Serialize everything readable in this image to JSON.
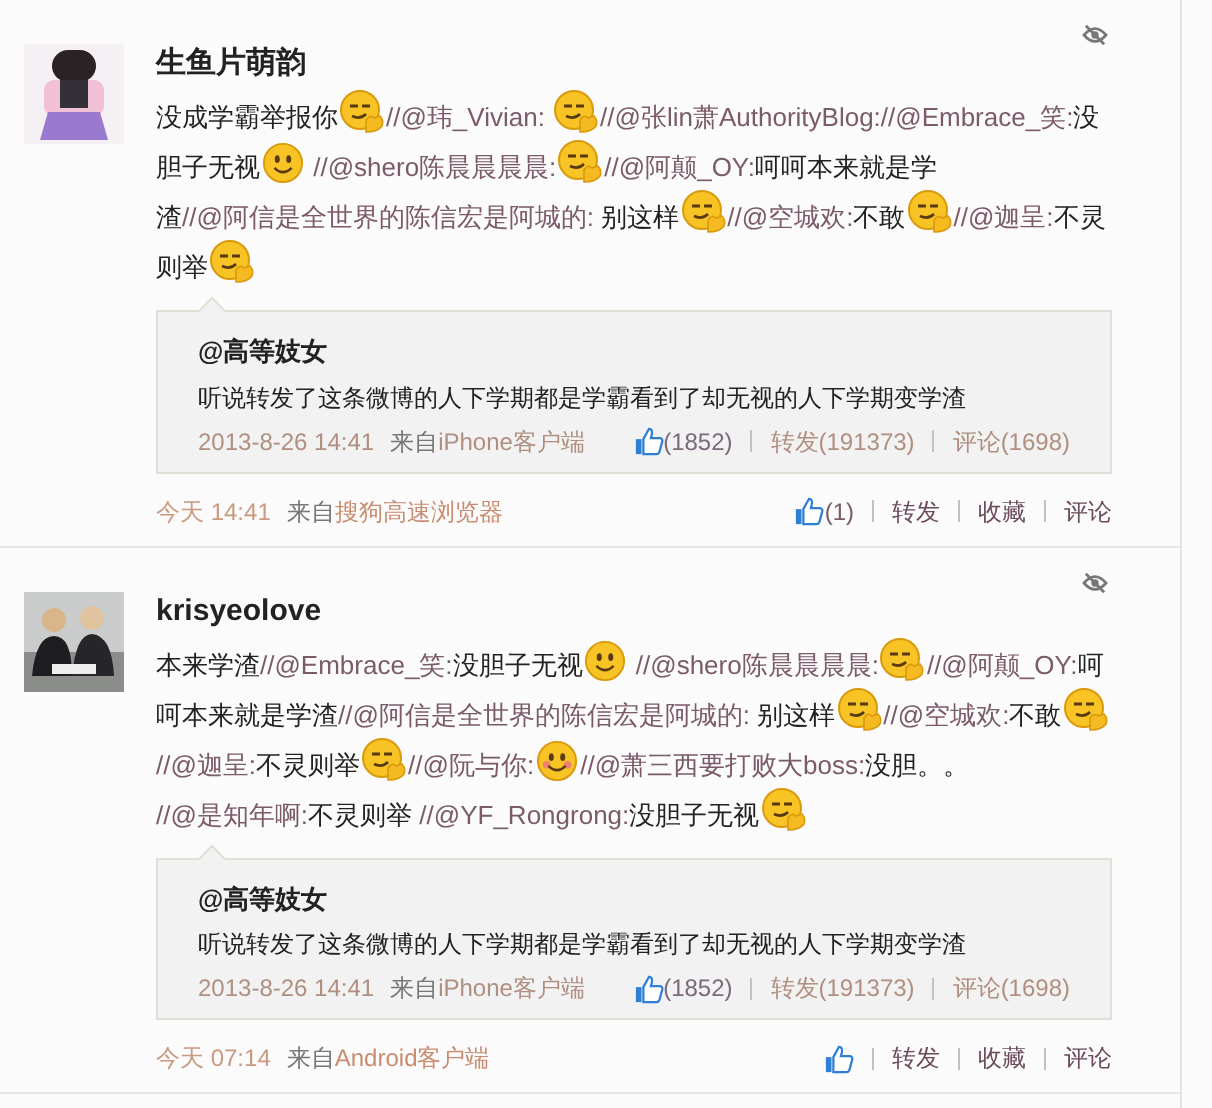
{
  "posts": [
    {
      "author": "生鱼片萌韵",
      "segments": [
        {
          "kind": "text",
          "text": "没成学霸举报你"
        },
        {
          "kind": "smirk"
        },
        {
          "kind": "mention",
          "text": "//@玮_Vivian: "
        },
        {
          "kind": "smirk"
        },
        {
          "kind": "mention",
          "text": "//@张lin萧AuthorityBlog:"
        },
        {
          "kind": "mention",
          "text": "//@Embrace_笑:"
        },
        {
          "kind": "text",
          "text": "没胆子无视"
        },
        {
          "kind": "smile"
        },
        {
          "kind": "mention",
          "text": " //@shero陈晨晨晨晨:"
        },
        {
          "kind": "smirk"
        },
        {
          "kind": "mention",
          "text": "//@阿颠_OY:"
        },
        {
          "kind": "text",
          "text": "呵呵本来就是学渣"
        },
        {
          "kind": "mention",
          "text": "//@阿信是全世界的陈信宏是阿城的:"
        },
        {
          "kind": "text",
          "text": " 别这样"
        },
        {
          "kind": "smirk"
        },
        {
          "kind": "mention",
          "text": "//@空城欢:"
        },
        {
          "kind": "text",
          "text": "不敢"
        },
        {
          "kind": "smirk"
        },
        {
          "kind": "mention",
          "text": "//@迦呈:"
        },
        {
          "kind": "text",
          "text": "不灵则举"
        },
        {
          "kind": "smirk"
        }
      ],
      "retweet": {
        "author": "@高等妓女",
        "text": "听说转发了这条微博的人下学期都是学霸看到了却无视的人下学期变学渣",
        "time": "2013-8-26 14:41",
        "source_label": "来自",
        "source": "iPhone客户端",
        "likes": "(1852)",
        "reposts": "转发(191373)",
        "comments": "评论(1698)"
      },
      "time": "今天 14:41",
      "source_label": "来自",
      "source": "搜狗高速浏览器",
      "likes": "(1)",
      "actions": [
        "转发",
        "收藏",
        "评论"
      ]
    },
    {
      "author": "krisyeolove",
      "segments": [
        {
          "kind": "text",
          "text": "本来学渣"
        },
        {
          "kind": "mention",
          "text": "//@Embrace_笑:"
        },
        {
          "kind": "text",
          "text": "没胆子无视"
        },
        {
          "kind": "smile"
        },
        {
          "kind": "mention",
          "text": " //@shero陈晨晨晨晨:"
        },
        {
          "kind": "smirk"
        },
        {
          "kind": "mention",
          "text": "//@阿颠_OY:"
        },
        {
          "kind": "text",
          "text": "呵呵本来就是学渣"
        },
        {
          "kind": "mention",
          "text": "//@阿信是全世界的陈信宏是阿城的:"
        },
        {
          "kind": "text",
          "text": " 别这样"
        },
        {
          "kind": "smirk"
        },
        {
          "kind": "mention",
          "text": "//@空城欢:"
        },
        {
          "kind": "text",
          "text": "不敢"
        },
        {
          "kind": "smirk"
        },
        {
          "kind": "mention",
          "text": "//@迦呈:"
        },
        {
          "kind": "text",
          "text": "不灵则举"
        },
        {
          "kind": "smirk"
        },
        {
          "kind": "mention",
          "text": "//@阮与你:"
        },
        {
          "kind": "blush"
        },
        {
          "kind": "mention",
          "text": "//@萧三西要打败大boss:"
        },
        {
          "kind": "text",
          "text": "没胆。。 "
        },
        {
          "kind": "mention",
          "text": "//@是知年啊:"
        },
        {
          "kind": "text",
          "text": "不灵则举 "
        },
        {
          "kind": "mention",
          "text": "//@YF_Rongrong:"
        },
        {
          "kind": "text",
          "text": "没胆子无视"
        },
        {
          "kind": "smirk"
        }
      ],
      "retweet": {
        "author": "@高等妓女",
        "text": "听说转发了这条微博的人下学期都是学霸看到了却无视的人下学期变学渣",
        "time": "2013-8-26 14:41",
        "source_label": "来自",
        "source": "iPhone客户端",
        "likes": "(1852)",
        "reposts": "转发(191373)",
        "comments": "评论(1698)"
      },
      "time": "今天 07:14",
      "source_label": "来自",
      "source": "Android客户端",
      "actions": [
        "转发",
        "收藏",
        "评论"
      ]
    }
  ]
}
